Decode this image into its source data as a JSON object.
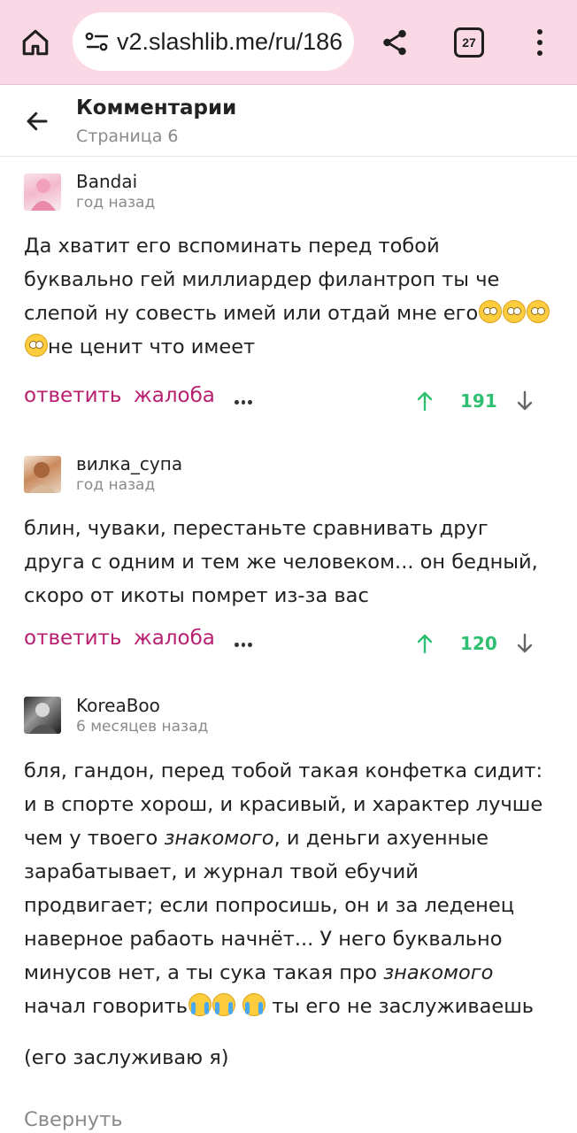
{
  "browser": {
    "url": "v2.slashlib.me/ru/186",
    "tab_count": "27"
  },
  "header": {
    "title": "Комментарии",
    "subtitle": "Страница 6"
  },
  "actions": {
    "reply_label": "ответить",
    "report_label": "жалоба"
  },
  "comments": [
    {
      "username": "Bandai",
      "date": "год назад",
      "text_part1": "Да хватит его вспоминать перед тобой буквально гей миллиардер филантроп ты че слепой ну совесть имей или отдай мне его",
      "text_part2": "не ценит что имеет",
      "score": "191"
    },
    {
      "username": "вилка_супа",
      "date": "год назад",
      "text": "блин, чуваки, перестаньте сравнивать друг друга с одним и тем же человеком... он бедный, скоро от икоты помрет из-за вас",
      "score": "120"
    },
    {
      "username": "KoreaBoo",
      "date": "6 месяцев назад",
      "text_a": "бля, гандон, перед тобой такая конфетка сидит: и в спорте хорош, и красивый, и характер лучше чем у твоего ",
      "text_em1": "знакомого",
      "text_b": ", и деньги ахуенные зарабатывает, и журнал твой ебучий продвигает; если попросишь, он и за леденец наверное рабаоть начнёт... У него буквально минусов нет, а ты сука такая про ",
      "text_em2": "знакомого",
      "text_c": " начал говорить",
      "text_d": " ты его не заслуживаешь",
      "text_p2": "(его заслуживаю я)"
    }
  ],
  "collapse_label": "Свернуть"
}
